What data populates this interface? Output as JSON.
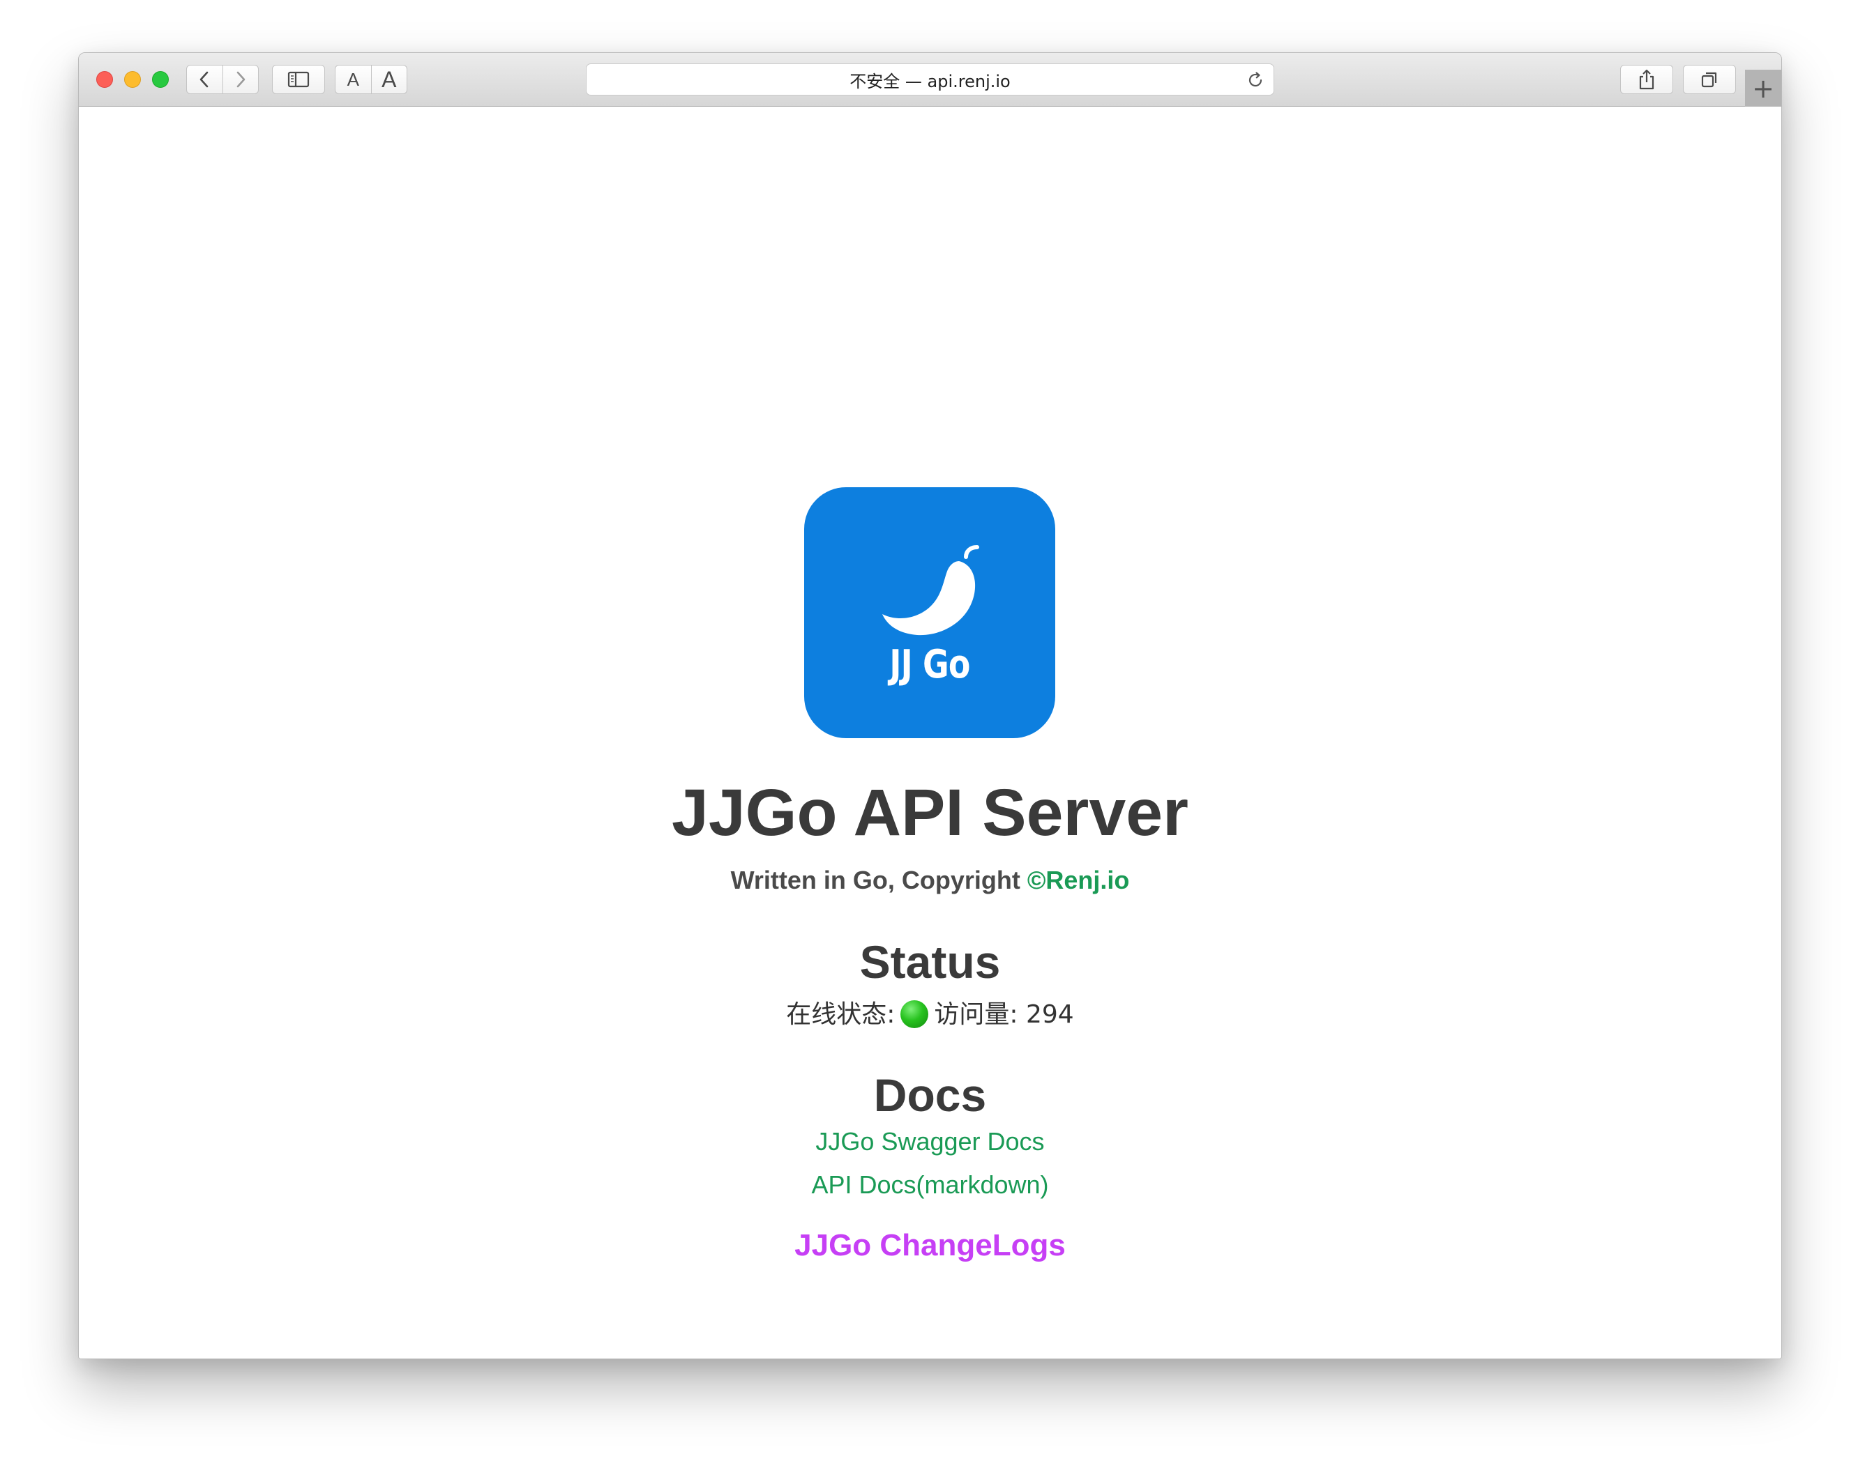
{
  "browser": {
    "address": "不安全 — api.renj.io",
    "font_small_label": "A",
    "font_large_label": "A",
    "new_tab_label": "+"
  },
  "page": {
    "logo_text": "JJ Go",
    "title": "JJGo API Server",
    "subtitle_prefix": "Written in Go, Copyright ",
    "subtitle_author": "©Renj.io",
    "status_heading": "Status",
    "status_label": "在线状态:",
    "status_indicator": "online",
    "visits_label": "访问量:",
    "visits_value": "294",
    "docs_heading": "Docs",
    "links": {
      "swagger": "JJGo Swagger Docs",
      "markdown": "API Docs(markdown)",
      "changelog": "JJGo ChangeLogs"
    }
  },
  "colors": {
    "logo_bg": "#0d7fdf",
    "link_green": "#1a9a55",
    "changelog_purple": "#c63ff5",
    "status_green": "#27c21f"
  }
}
